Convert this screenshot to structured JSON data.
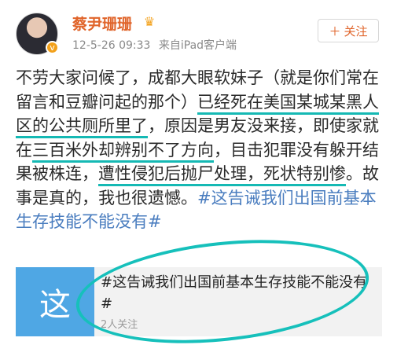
{
  "user": {
    "name": "蔡尹珊珊",
    "badge": "v",
    "crown_icon": "crown-icon",
    "time": "12-5-26 09:33",
    "source": "来自iPad客户端"
  },
  "follow": {
    "label": "关注",
    "icon": "plus-icon"
  },
  "post": {
    "seg1": "不劳大家问候了，成都大眼软妹子（就是你们常在留言和豆瓣问起的那个）",
    "hl1": "已经死在美国某城某黑人区的公共厕所里了",
    "seg2": "，原因是男友没来接，即使家就在",
    "hl2": "三百米外却辨别不了方向",
    "seg3": "，目击犯罪没有躲开结果被株连，",
    "hl3": "遭性侵犯后抛尸处理，死状特别惨",
    "seg4": "。故事是真的，我也很遗憾。",
    "hashtag": "#这告诫我们出国前基本生存技能不能没有#"
  },
  "card": {
    "thumb": "这",
    "title": "#这告诫我们出国前基本生存技能不能没有#",
    "subtitle": "2人关注"
  },
  "colors": {
    "accent": "#e0642a",
    "link": "#4a7dbf",
    "highlight": "#15b9b4",
    "thumb": "#4fa7e4"
  }
}
